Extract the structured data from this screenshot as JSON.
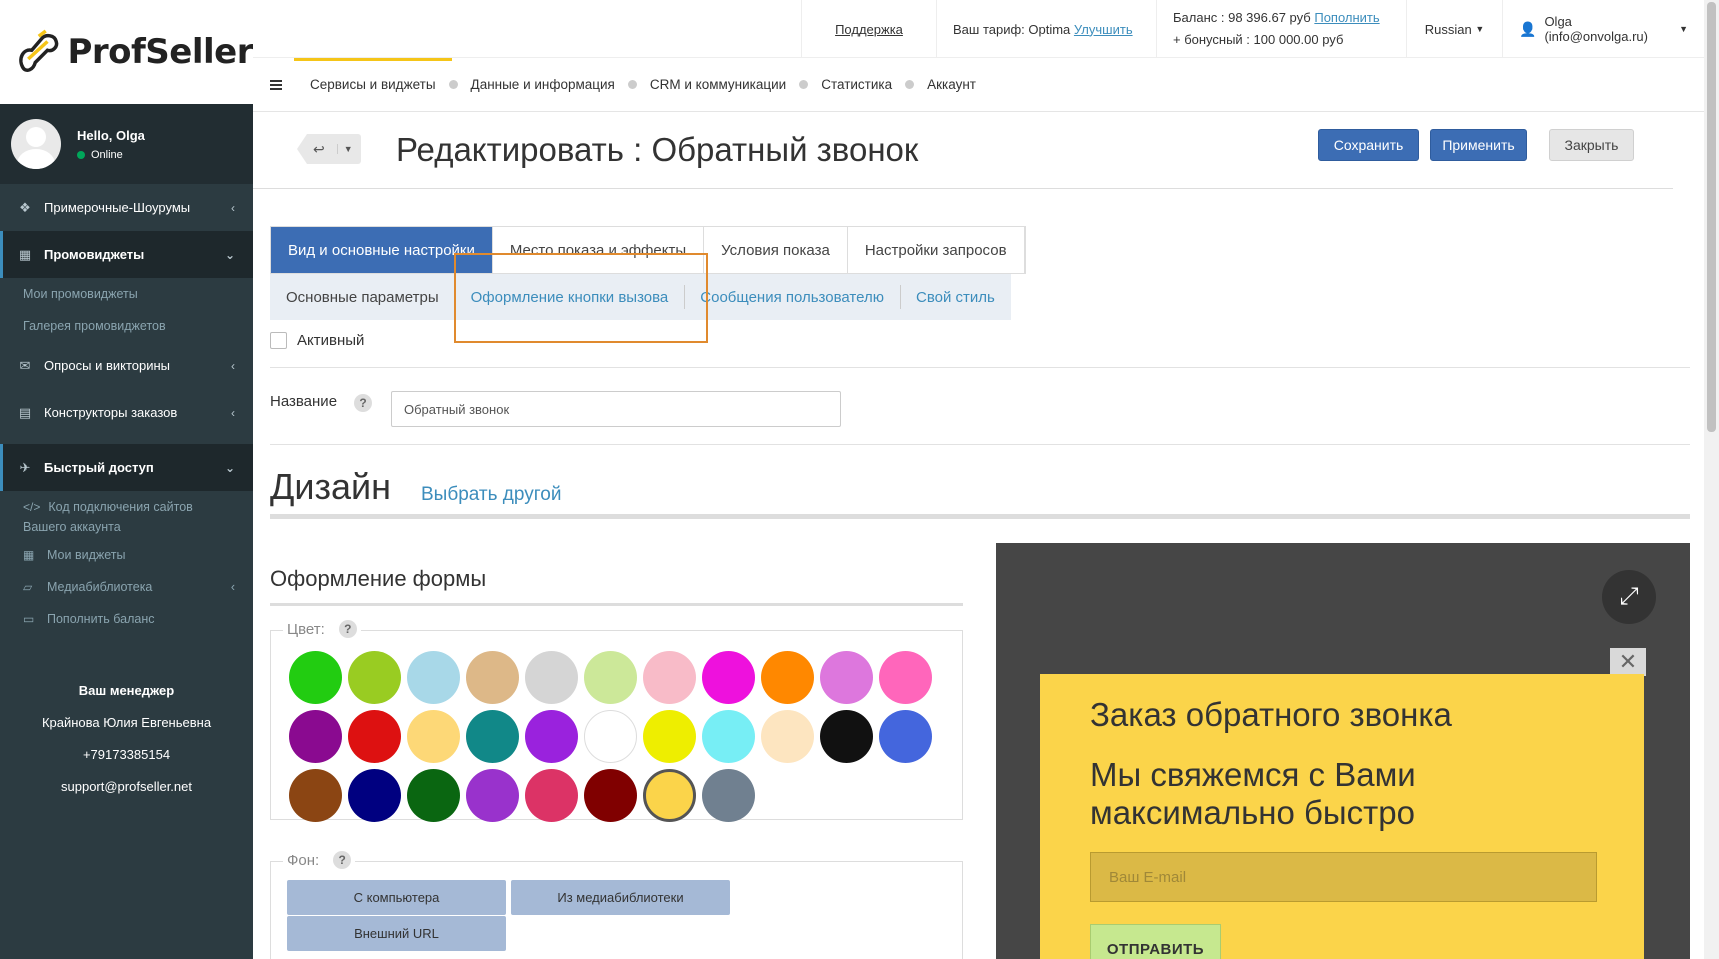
{
  "app": {
    "logo_text": "ProfSeller"
  },
  "user": {
    "hello": "Hello, Olga",
    "status": "Online"
  },
  "sidebar": {
    "items": [
      {
        "label": "Примерочные-Шоурумы"
      },
      {
        "label": "Промовиджеты"
      },
      {
        "label": "Опросы и викторины"
      },
      {
        "label": "Конструкторы заказов"
      },
      {
        "label": "Быстрый доступ"
      }
    ],
    "promo_sub": [
      "Мои промовиджеты",
      "Галерея промовиджетов"
    ],
    "quick_sub": [
      "Код подключения сайтов Вашего аккаунта",
      "Мои виджеты",
      "Медиабиблиотека",
      "Пополнить баланс"
    ],
    "manager": {
      "title": "Ваш менеджер",
      "name": "Крайнова Юлия Евгеньевна",
      "phone": "+79173385154",
      "email": "support@profseller.net"
    }
  },
  "header": {
    "support": "Поддержка",
    "tariff_label": "Ваш тариф: Optima",
    "tariff_upgrade": "Улучшить",
    "balance_label": "Баланс : 98 396.67 руб",
    "balance_topup": "Пополнить",
    "bonus_label": "+ бонусный : 100 000.00 руб",
    "language": "Russian",
    "account": "Olga (info@onvolga.ru)"
  },
  "menu": [
    "Сервисы и виджеты",
    "Данные и информация",
    "CRM и коммуникации",
    "Статистика",
    "Аккаунт"
  ],
  "page": {
    "title": "Редактировать : Обратный звонок",
    "save": "Сохранить",
    "apply": "Применить",
    "close": "Закрыть"
  },
  "tabs": [
    "Вид и основные настройки",
    "Место показа и эффекты",
    "Условия показа",
    "Настройки запросов"
  ],
  "subtabs": [
    "Основные параметры",
    "Оформление кнопки вызова",
    "Сообщения пользователю",
    "Свой стиль"
  ],
  "form": {
    "active_label": "Активный",
    "name_label": "Название",
    "help_mark": "?",
    "name_value": "Обратный звонок",
    "design_title": "Дизайн",
    "design_link": "Выбрать другой",
    "form_title": "Оформление формы",
    "color_label": "Цвет:",
    "bg_label": "Фон:",
    "bg_buttons": [
      "С компьютера",
      "Из медиабиблиотеки",
      "Внешний URL"
    ]
  },
  "colors": [
    "#22cc11",
    "#99cc22",
    "#a8d8e8",
    "#ddb888",
    "#d5d5d5",
    "#cce899",
    "#f8bbc8",
    "#ee11dd",
    "#ff8800",
    "#dd77dd",
    "#ff66bb",
    "#8a0a90",
    "#dd1111",
    "#fdd877",
    "#118888",
    "#9a22dd",
    "#ffffff",
    "#eeee00",
    "#77eef5",
    "#fde5c0",
    "#111111",
    "#4466dd",
    "#8b4513",
    "#000080",
    "#0a6611",
    "#9932cc",
    "#dc3366",
    "#800000",
    "#fbd44a",
    "#708090"
  ],
  "selected_color_index": 28,
  "preview": {
    "title": "Заказ обратного звонка",
    "subtitle": "Мы свяжемся с Вами максимально быстро",
    "email_placeholder": "Ваш E-mail",
    "submit": "ОТПРАВИТЬ"
  }
}
